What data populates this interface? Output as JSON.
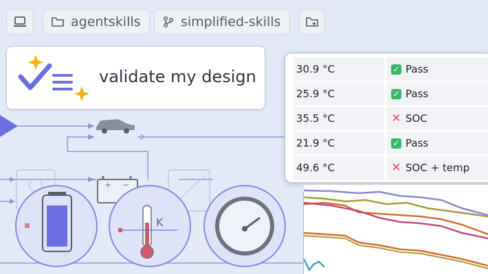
{
  "toolbar": {
    "device_icon": "laptop-icon",
    "folder_chip": {
      "icon": "folder-icon",
      "label": "agentskills"
    },
    "branch_chip": {
      "icon": "git-branch-icon",
      "label": "simplified-skills"
    },
    "new_folder_icon": "folder-plus-icon"
  },
  "prompt": {
    "icon": "checklist-sparkle-icon",
    "text": "validate my design"
  },
  "results": [
    {
      "temp": "30.9 °C",
      "status": "pass",
      "label": "Pass"
    },
    {
      "temp": "25.9 °C",
      "status": "pass",
      "label": "Pass"
    },
    {
      "temp": "35.5 °C",
      "status": "fail",
      "label": "SOC"
    },
    {
      "temp": "21.9 °C",
      "status": "pass",
      "label": "Pass"
    },
    {
      "temp": "49.6 °C",
      "status": "fail",
      "label": "SOC + temp"
    }
  ],
  "diagram": {
    "blocks": [
      "car-icon",
      "battery-icon",
      "thermometer-icon",
      "gauge-icon",
      "cell-battery-icon"
    ],
    "labels": {
      "thermo_k": "K"
    }
  },
  "colors": {
    "accent": "#6b6fe0",
    "pass": "#3ab864",
    "fail": "#e0476a",
    "wire": "#8f96d8"
  }
}
